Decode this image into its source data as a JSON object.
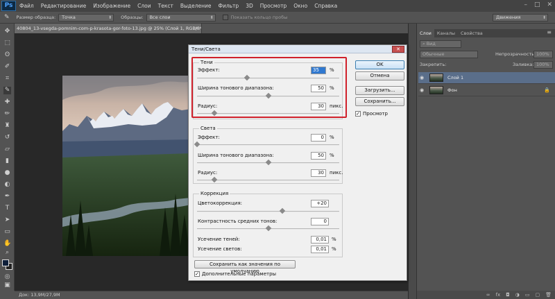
{
  "app": {
    "logo": "Ps",
    "menu": [
      "Файл",
      "Редактирование",
      "Изображение",
      "Слои",
      "Текст",
      "Выделение",
      "Фильтр",
      "3D",
      "Просмотр",
      "Окно",
      "Справка"
    ]
  },
  "options_bar": {
    "sample_size_label": "Размер образца:",
    "sample_size_value": "Точка",
    "samples_label": "Образцы:",
    "samples_value": "Все слои",
    "show_ring_label": "Показать кольцо пробы",
    "workspace_value": "Движения"
  },
  "document": {
    "tab_title": "40804_13-vsegda-pomnim-com-p-krasota-gor-foto-13.jpg @ 25% (Слой 1, RGB/8*) *",
    "status_text": "Док: 13,9М/27,9М"
  },
  "layers_panel": {
    "tabs": [
      "Слои",
      "Каналы",
      "Свойства"
    ],
    "kind_label": "Вид",
    "blend_mode": "Обычные",
    "opacity_label": "Непрозрачность:",
    "opacity_value": "100%",
    "lock_label": "Закрепить:",
    "fill_label": "Заливка:",
    "fill_value": "100%",
    "layers": [
      {
        "name": "Слой 1",
        "selected": true
      },
      {
        "name": "Фон",
        "selected": false
      }
    ],
    "bottom_icons": [
      "link-icon",
      "fx-icon",
      "mask-icon",
      "adjustment-icon",
      "folder-icon",
      "new-layer-icon",
      "trash-icon"
    ]
  },
  "dialog": {
    "title": "Тени/Света",
    "shadows": {
      "title": "Тени",
      "amount_label": "Эффект:",
      "amount_value": "35",
      "amount_unit": "%",
      "amount_fraction": 0.35,
      "tonal_width_label": "Ширина тонового диапазона:",
      "tonal_width_value": "50",
      "tonal_width_unit": "%",
      "tonal_width_fraction": 0.5,
      "radius_label": "Радиус:",
      "radius_value": "30",
      "radius_unit": "пикс.",
      "radius_fraction": 0.12
    },
    "highlights": {
      "title": "Света",
      "amount_label": "Эффект:",
      "amount_value": "0",
      "amount_unit": "%",
      "amount_fraction": 0.0,
      "tonal_width_label": "Ширина тонового диапазона:",
      "tonal_width_value": "50",
      "tonal_width_unit": "%",
      "tonal_width_fraction": 0.5,
      "radius_label": "Радиус:",
      "radius_value": "30",
      "radius_unit": "пикс.",
      "radius_fraction": 0.12
    },
    "correction": {
      "title": "Коррекция",
      "color_label": "Цветокоррекция:",
      "color_value": "+20",
      "color_fraction": 0.6,
      "midtone_label": "Контрастность средних тонов:",
      "midtone_value": "0",
      "midtone_fraction": 0.5,
      "black_clip_label": "Усечение теней:",
      "black_clip_value": "0,01",
      "black_clip_unit": "%",
      "white_clip_label": "Усечение светов:",
      "white_clip_value": "0,01",
      "white_clip_unit": "%"
    },
    "buttons": {
      "ok": "OK",
      "cancel": "Отмена",
      "load": "Загрузить...",
      "save": "Сохранить...",
      "preview": "Просмотр",
      "save_defaults": "Сохранить как значения по умолчанию",
      "more_options": "Дополнительные параметры"
    },
    "preview_checked": true,
    "more_options_checked": true
  }
}
